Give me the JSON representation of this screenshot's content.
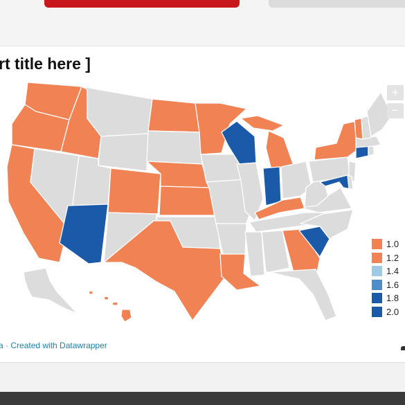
{
  "header": {
    "tab_active_color": "#c8161d",
    "tab_inactive_color": "#dcdcdc"
  },
  "chart": {
    "title": "rt title here ]",
    "zoom_in_label": "+",
    "zoom_out_label": "−",
    "legend": [
      {
        "label": "1.0",
        "color": "#f08254"
      },
      {
        "label": "1.2",
        "color": "#f08254"
      },
      {
        "label": "1.4",
        "color": "#9fcae3"
      },
      {
        "label": "1.6",
        "color": "#4e8ec8"
      },
      {
        "label": "1.8",
        "color": "#1b5aa8"
      },
      {
        "label": "2.0",
        "color": "#1b5aa8"
      }
    ],
    "colors": {
      "no_data": "#dcdcdc",
      "low": "#f08254",
      "high": "#1b5aa8",
      "border": "#ffffff"
    },
    "states_low": [
      "WA",
      "OR",
      "ID",
      "CA",
      "CO",
      "NE",
      "KS",
      "TX",
      "LA",
      "ND",
      "MN",
      "MI",
      "KY",
      "GA",
      "NY",
      "VT",
      "HI"
    ],
    "states_high": [
      "AZ",
      "WI",
      "IN",
      "SC",
      "MD",
      "CT"
    ],
    "states_no_data": [
      "MT",
      "WY",
      "NV",
      "UT",
      "NM",
      "SD",
      "IA",
      "MO",
      "OK",
      "AR",
      "MS",
      "AL",
      "FL",
      "TN",
      "IL",
      "OH",
      "WV",
      "VA",
      "NC",
      "PA",
      "NJ",
      "DE",
      "MA",
      "RI",
      "NH",
      "ME",
      "AK"
    ]
  },
  "footer": {
    "source_fragment": "a",
    "separator": " · ",
    "credit_text": "Created with Datawrapper"
  }
}
